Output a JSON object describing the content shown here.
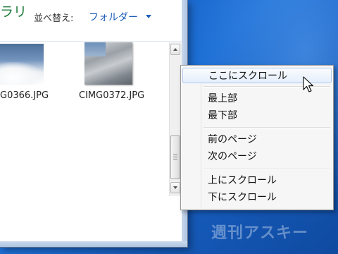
{
  "window": {
    "title_fragment": "ラリ",
    "sort": {
      "label": "並べ替え:",
      "value": "フォルダー"
    }
  },
  "files": [
    {
      "name": "G0366.JPG"
    },
    {
      "name": "CIMG0372.JPG"
    }
  ],
  "context_menu": {
    "items": [
      {
        "label": "ここにスクロール"
      },
      {
        "label": "最上部"
      },
      {
        "label": "最下部"
      },
      {
        "label": "前のページ"
      },
      {
        "label": "次のページ"
      },
      {
        "label": "上にスクロール"
      },
      {
        "label": "下にスクロール"
      }
    ]
  },
  "watermark": "週刊アスキー",
  "colors": {
    "desktop": "#1d6fd6",
    "sort_link": "#1f5fb8",
    "title": "#1e7a3a"
  }
}
